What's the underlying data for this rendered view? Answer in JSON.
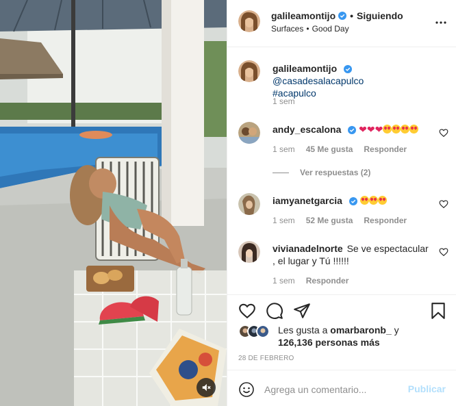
{
  "post": {
    "author": {
      "username": "galileamontijo",
      "verified": true,
      "follow_status": "Siguiendo",
      "audio": "Surfaces",
      "track": "Good Day",
      "avatar_icon": "profile-photo"
    },
    "caption": {
      "username": "galileamontijo",
      "mention": "@casadesalacapulco",
      "hashtag": "#acapulco",
      "time": "1 sem"
    },
    "comments": [
      {
        "username": "andy_escalona",
        "verified": true,
        "text_emoji": "❤❤❤😍😍😍😍",
        "time": "1 sem",
        "likes": "45 Me gusta",
        "reply_label": "Responder",
        "view_replies": "Ver respuestas (2)"
      },
      {
        "username": "iamyanetgarcia",
        "verified": true,
        "text_emoji": "😍😍😍",
        "time": "1 sem",
        "likes": "52 Me gusta",
        "reply_label": "Responder"
      },
      {
        "username": "vivianadelnorte",
        "verified": false,
        "text": "Se ve espectacular , el lugar y Tú !!!!!!",
        "time": "1 sem",
        "reply_label": "Responder"
      }
    ],
    "likes": {
      "prefix": "Les gusta a",
      "first_user": "omarbaronb_",
      "conjunction": "y",
      "others": "126,136 personas más"
    },
    "date": "28 DE FEBRERO",
    "comment_box": {
      "placeholder": "Agrega un comentario...",
      "publish_label": "Publicar"
    }
  },
  "colors": {
    "verified_blue": "#3897f0",
    "link": "#00376b",
    "muted": "#8e8e8e",
    "publish_disabled": "#b2dffc",
    "heart_red": "#e0245e"
  },
  "icons": {
    "header_more": "more-horizontal-icon",
    "like": "heart-outline-icon",
    "comment": "comment-bubble-icon",
    "share": "paper-plane-icon",
    "save": "bookmark-icon",
    "emoji": "smiley-icon",
    "mute": "speaker-muted-icon"
  }
}
